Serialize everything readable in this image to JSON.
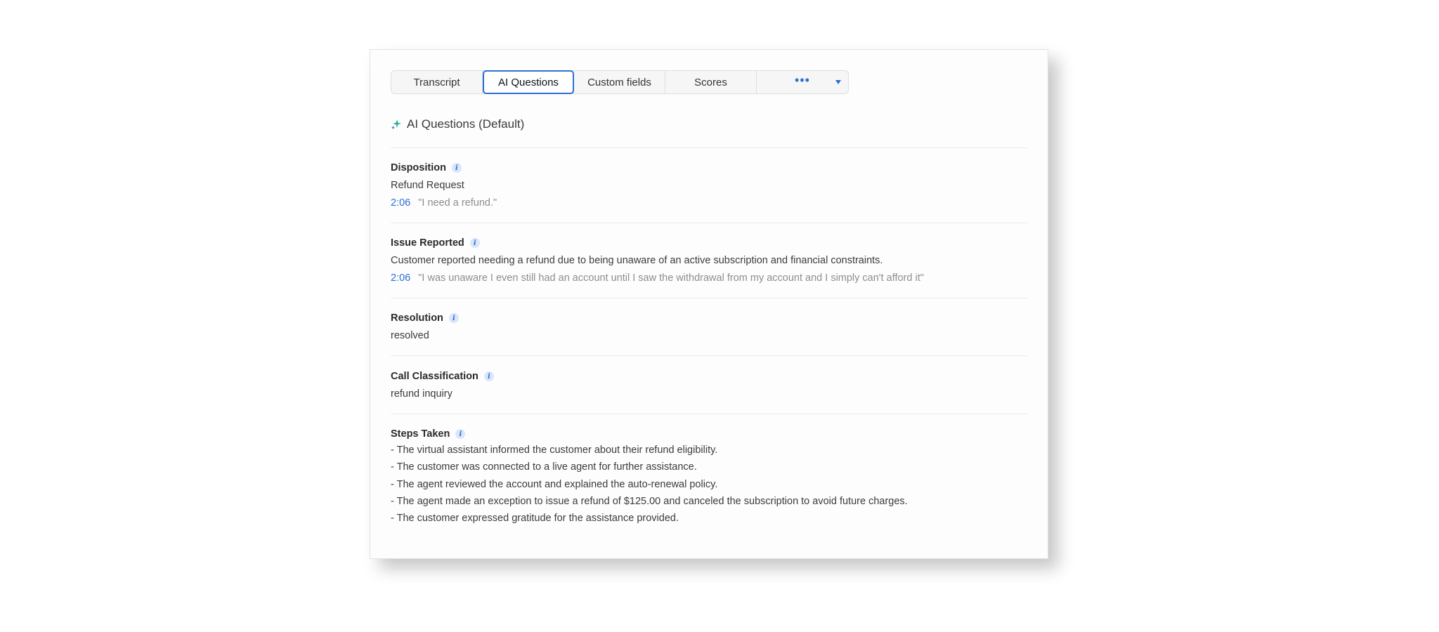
{
  "tabs": [
    {
      "label": "Transcript",
      "active": false
    },
    {
      "label": "AI Questions",
      "active": true
    },
    {
      "label": "Custom fields",
      "active": false
    },
    {
      "label": "Scores",
      "active": false
    }
  ],
  "more_tab": {
    "dots": "•••"
  },
  "section": {
    "title": "AI Questions (Default)"
  },
  "info_glyph": "i",
  "items": {
    "disposition": {
      "label": "Disposition",
      "value": "Refund Request",
      "timestamp": "2:06",
      "quote": "\"I need a refund.\""
    },
    "issue": {
      "label": "Issue Reported",
      "value": "Customer reported needing a refund due to being unaware of an active subscription and financial constraints.",
      "timestamp": "2:06",
      "quote": "\"I was unaware I even still had an account until I saw the withdrawal from my account and I simply can't afford it\""
    },
    "resolution": {
      "label": "Resolution",
      "value": "resolved"
    },
    "classification": {
      "label": "Call Classification",
      "value": "refund inquiry"
    },
    "steps": {
      "label": "Steps Taken",
      "lines": [
        "- The virtual assistant informed the customer about their refund eligibility.",
        "- The customer was connected to a live agent for further assistance.",
        "- The agent reviewed the account and explained the auto-renewal policy.",
        "- The agent made an exception to issue a refund of $125.00 and canceled the subscription to avoid future charges.",
        "- The customer expressed gratitude for the assistance provided."
      ]
    }
  },
  "colors": {
    "accent": "#2d6fd4",
    "sparkle": "#19b394",
    "quote": "#8d8d8d"
  }
}
